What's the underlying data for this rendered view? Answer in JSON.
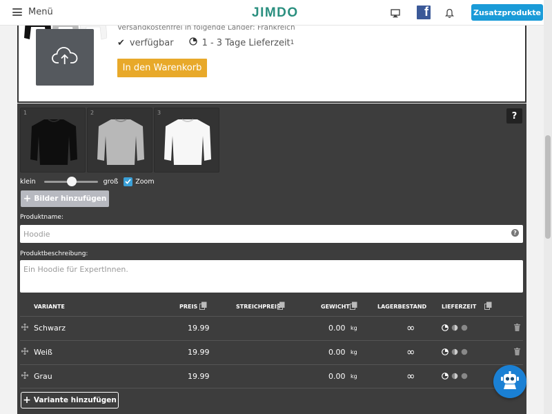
{
  "topbar": {
    "menu_label": "Menü",
    "logo": "JIMDO",
    "desktop_icon": "desktop-icon",
    "facebook_icon": "facebook-icon",
    "facebook_letter": "f",
    "bell_icon": "bell-icon",
    "addons_label": "Zusatzprodukte",
    "accent_color": "#1a9bd8",
    "logo_color": "#2a8f7f"
  },
  "preview": {
    "shipping_text": "Versandkostenfrei in folgende Länder: Frankreich",
    "availability": "verfügbar",
    "delivery_time": "1 - 3 Tage Lieferzeit",
    "delivery_sup": "1",
    "cart_button": "In den Warenkorb",
    "cart_color": "#e8a92a",
    "upload_icon": "cloud-upload-icon"
  },
  "editor": {
    "images": [
      {
        "num": "1",
        "color": "black"
      },
      {
        "num": "2",
        "color": "grey"
      },
      {
        "num": "3",
        "color": "white"
      }
    ],
    "help_label": "?",
    "size_small": "klein",
    "size_large": "groß",
    "zoom_label": "Zoom",
    "zoom_checked": true,
    "add_images_label": "Bilder hinzufügen",
    "product_name_label": "Produktname:",
    "product_name_placeholder": "Hoodie",
    "description_label": "Produktbeschreibung:",
    "description_placeholder": "Ein Hoodie für ExpertInnen."
  },
  "variants": {
    "headers": {
      "name": "VARIANTE",
      "price": "PREIS",
      "strike_price": "STREICHPREIS",
      "weight": "GEWICHT",
      "stock": "LAGERBESTAND",
      "delivery": "LIEFERZEIT"
    },
    "rows": [
      {
        "name": "Schwarz",
        "price": "19.99",
        "weight": "0.00",
        "unit": "kg",
        "stock": "∞"
      },
      {
        "name": "Weiß",
        "price": "19.99",
        "weight": "0.00",
        "unit": "kg",
        "stock": "∞"
      },
      {
        "name": "Grau",
        "price": "19.99",
        "weight": "0.00",
        "unit": "kg",
        "stock": "∞"
      }
    ],
    "add_variant_label": "Variante hinzufügen"
  },
  "chatbot_icon": "robot-icon"
}
